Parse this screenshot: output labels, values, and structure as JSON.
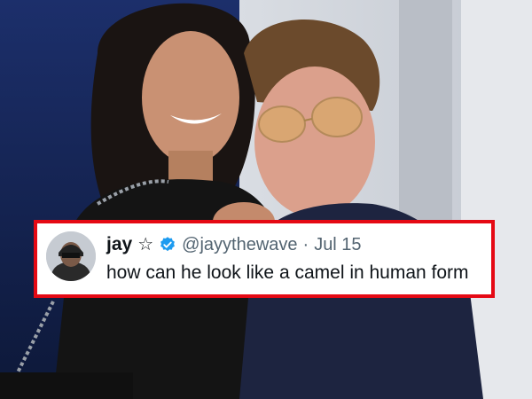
{
  "tweet": {
    "display_name": "jay",
    "star_icon": "☆",
    "verified_icon": "verified-badge-icon",
    "handle": "@jayythewave",
    "separator": "·",
    "date": "Jul 15",
    "text": "how can he look like a camel in human form"
  },
  "colors": {
    "card_border": "#e50914",
    "verified_blue": "#1d9bf0",
    "muted_text": "#536471"
  }
}
